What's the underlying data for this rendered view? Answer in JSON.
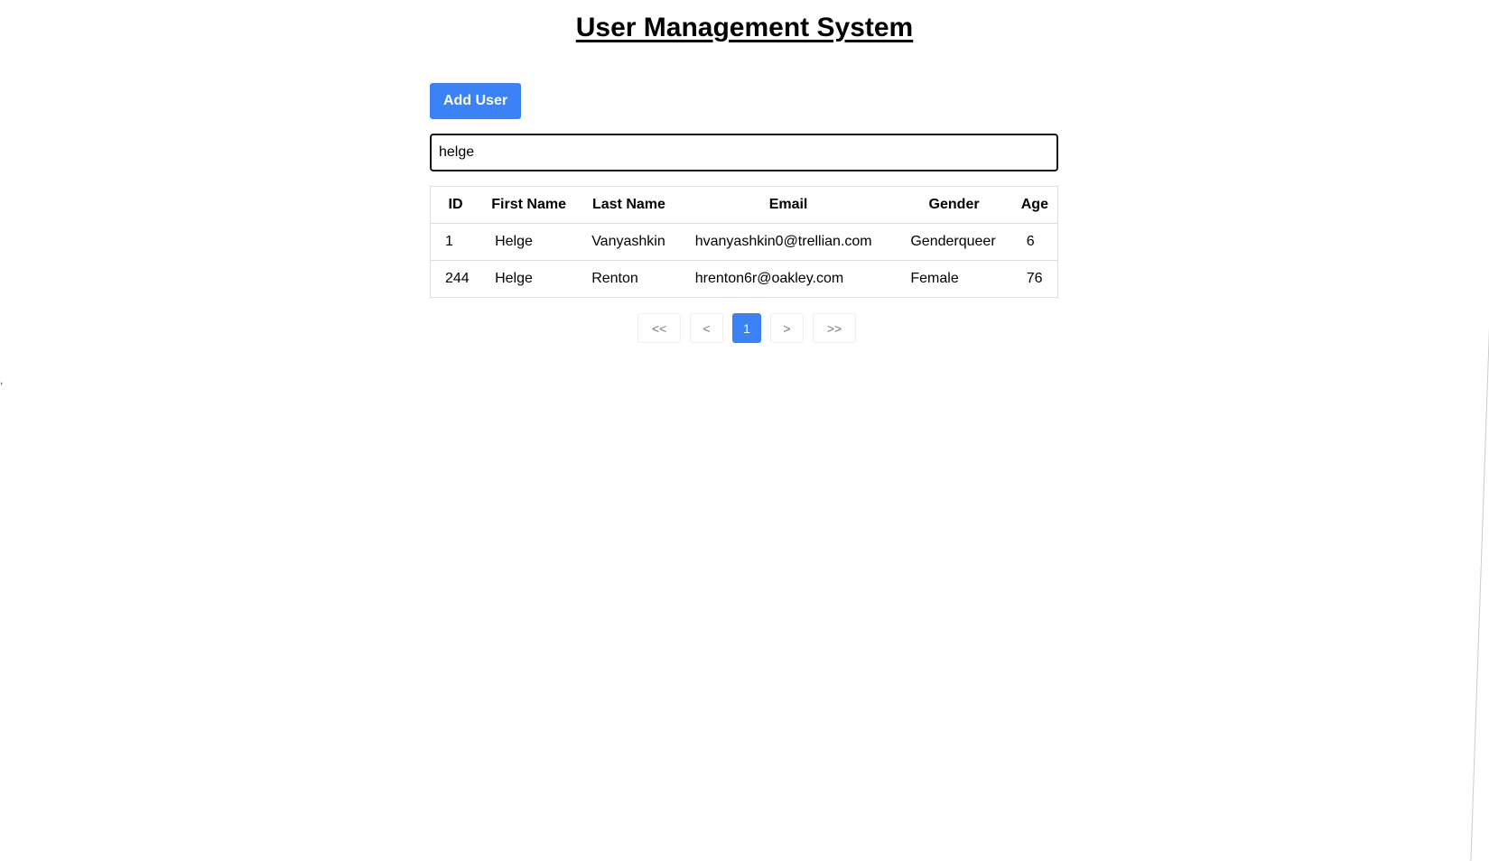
{
  "header": {
    "title": "User Management System"
  },
  "toolbar": {
    "add_user_label": "Add User"
  },
  "search": {
    "value": "helge",
    "placeholder": ""
  },
  "table": {
    "columns": [
      "ID",
      "First Name",
      "Last Name",
      "Email",
      "Gender",
      "Age"
    ],
    "rows": [
      [
        "1",
        "Helge",
        "Vanyashkin",
        "hvanyashkin0@trellian.com",
        "Genderqueer",
        "6"
      ],
      [
        "244",
        "Helge",
        "Renton",
        "hrenton6r@oakley.com",
        "Female",
        "76"
      ]
    ]
  },
  "pagination": {
    "first": "<<",
    "prev": "<",
    "current": "1",
    "next": ">",
    "last": ">>"
  },
  "stray_mark": ",",
  "colors": {
    "accent": "#3b82f6",
    "border": "#dddddd"
  }
}
